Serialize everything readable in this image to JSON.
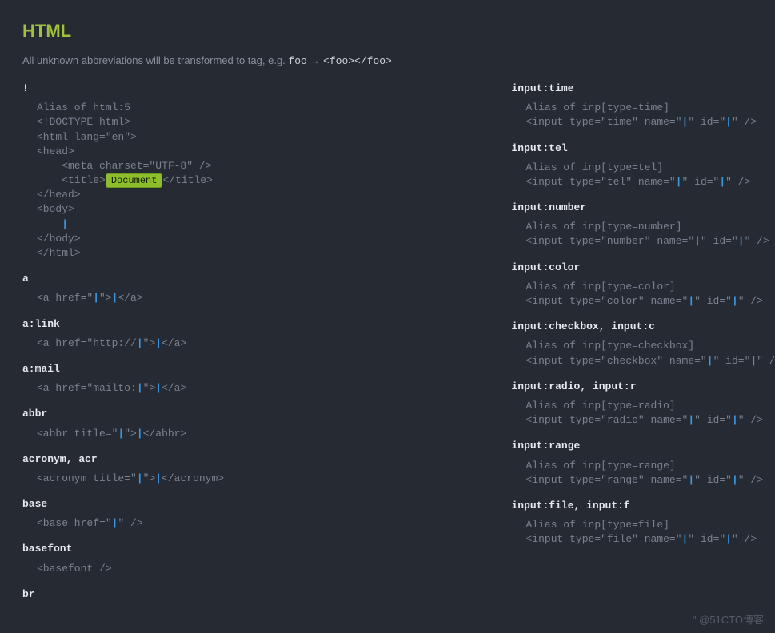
{
  "title": "HTML",
  "intro_prefix": "All unknown abbreviations will be transformed to tag, e.g. ",
  "intro_foo": "foo",
  "intro_arrow": " → ",
  "intro_foox": "<foo></foo>",
  "watermark": "\" @51CTO博客",
  "left": [
    {
      "abbr": "!",
      "alias": "Alias of html:5",
      "code": true
    },
    {
      "abbr": "a",
      "exp": "<a href=\"|\">|</a>"
    },
    {
      "abbr": "a:link",
      "exp": "<a href=\"http://|\">|</a>"
    },
    {
      "abbr": "a:mail",
      "exp": "<a href=\"mailto:|\">|</a>"
    },
    {
      "abbr": "abbr",
      "exp": "<abbr title=\"|\">|</abbr>"
    },
    {
      "abbr": "acronym, acr",
      "exp": "<acronym title=\"|\">|</acronym>"
    },
    {
      "abbr": "base",
      "exp": "<base href=\"|\" />"
    },
    {
      "abbr": "basefont",
      "exp": "<basefont />"
    },
    {
      "abbr": "br",
      "exp": ""
    }
  ],
  "code_lines": [
    "<!DOCTYPE html>",
    "<html lang=\"en\">",
    "<head>",
    "    <meta charset=\"UTF-8\" />",
    "    <title>§Document§</title>",
    "</head>",
    "<body>",
    "    |",
    "</body>",
    "</html>"
  ],
  "right": [
    {
      "abbr": "input:time",
      "alias": "Alias of inp[type=time]",
      "exp": "<input type=\"time\" name=\"|\" id=\"|\" />"
    },
    {
      "abbr": "input:tel",
      "alias": "Alias of inp[type=tel]",
      "exp": "<input type=\"tel\" name=\"|\" id=\"|\" />"
    },
    {
      "abbr": "input:number",
      "alias": "Alias of inp[type=number]",
      "exp": "<input type=\"number\" name=\"|\" id=\"|\" />"
    },
    {
      "abbr": "input:color",
      "alias": "Alias of inp[type=color]",
      "exp": "<input type=\"color\" name=\"|\" id=\"|\" />"
    },
    {
      "abbr": "input:checkbox, input:c",
      "alias": "Alias of inp[type=checkbox]",
      "exp": "<input type=\"checkbox\" name=\"|\" id=\"|\" />"
    },
    {
      "abbr": "input:radio, input:r",
      "alias": "Alias of inp[type=radio]",
      "exp": "<input type=\"radio\" name=\"|\" id=\"|\" />"
    },
    {
      "abbr": "input:range",
      "alias": "Alias of inp[type=range]",
      "exp": "<input type=\"range\" name=\"|\" id=\"|\" />"
    },
    {
      "abbr": "input:file, input:f",
      "alias": "Alias of inp[type=file]",
      "exp": "<input type=\"file\" name=\"|\" id=\"|\" />"
    }
  ]
}
